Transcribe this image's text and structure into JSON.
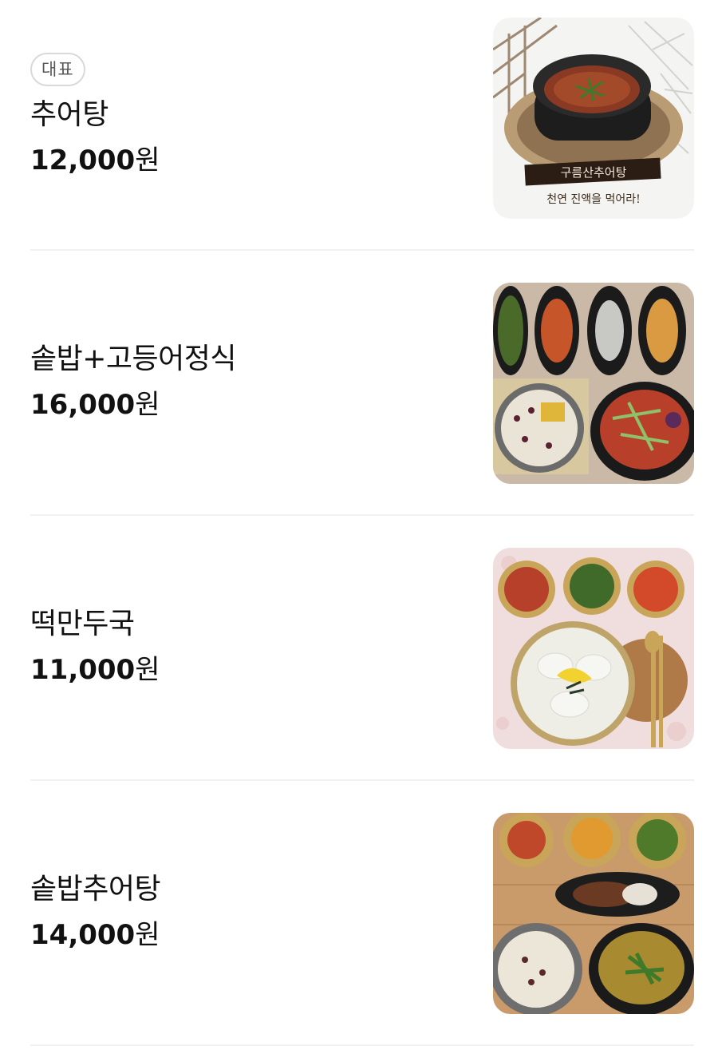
{
  "menu": {
    "items": [
      {
        "badge": "대표",
        "name": "추어탕",
        "price_num": "12,000",
        "price_unit": "원",
        "image": "chueotang-pot-image",
        "image_caption_title": "구름산추어탕",
        "image_caption_sub": "천연 진액을 먹어라!"
      },
      {
        "name": "솥밥+고등어정식",
        "price_num": "16,000",
        "price_unit": "원",
        "image": "pot-rice-mackerel-set-image"
      },
      {
        "name": "떡만두국",
        "price_num": "11,000",
        "price_unit": "원",
        "image": "rice-cake-dumpling-soup-image"
      },
      {
        "name": "솥밥추어탕",
        "price_num": "14,000",
        "price_unit": "원",
        "image": "pot-rice-chueotang-set-image"
      }
    ]
  },
  "colors": {
    "divider": "#f1f1f1",
    "badge_border": "#d9d9d9",
    "text": "#111111"
  }
}
